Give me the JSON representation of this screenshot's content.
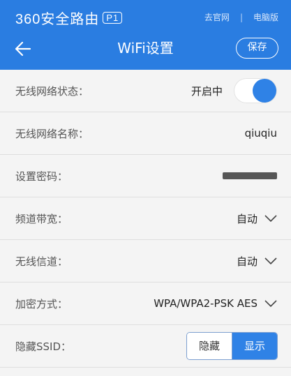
{
  "header": {
    "brand": "360安全路由",
    "model": "P1",
    "links": [
      "去官网",
      "电脑版"
    ],
    "separator": "|",
    "title": "WiFi设置",
    "save_label": "保存"
  },
  "settings": {
    "wireless_status": {
      "label": "无线网络状态：",
      "value": "开启中",
      "enabled": true
    },
    "network_name": {
      "label": "无线网络名称：",
      "value": "qiuqiu"
    },
    "password": {
      "label": "设置密码："
    },
    "bandwidth": {
      "label": "频道带宽：",
      "value": "自动"
    },
    "channel": {
      "label": "无线信道：",
      "value": "自动"
    },
    "encryption": {
      "label": "加密方式：",
      "value": "WPA/WPA2-PSK AES"
    },
    "hide_ssid": {
      "label": "隐藏SSID：",
      "options": [
        "隐藏",
        "显示"
      ],
      "selected": "显示"
    }
  },
  "colors": {
    "header_bg": "#2a7de1",
    "accent": "#2f82e6"
  },
  "icons": {
    "back": "arrow-left-icon",
    "dropdown": "chevron-down-icon"
  }
}
